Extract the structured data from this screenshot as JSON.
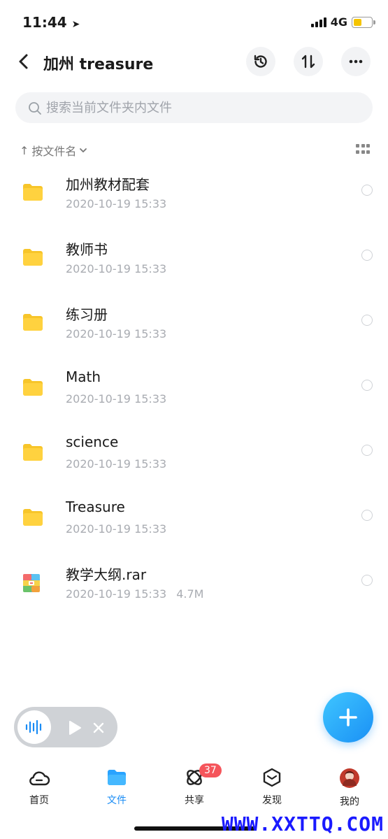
{
  "status_bar": {
    "time": "11:44",
    "network": "4G"
  },
  "header": {
    "title": "加州 treasure"
  },
  "search": {
    "placeholder": "搜索当前文件夹内文件"
  },
  "sort": {
    "label": "按文件名"
  },
  "files": [
    {
      "name": "加州教材配套",
      "date": "2020-10-19 15:33",
      "size": "",
      "type": "folder"
    },
    {
      "name": "教师书",
      "date": "2020-10-19 15:33",
      "size": "",
      "type": "folder"
    },
    {
      "name": "练习册",
      "date": "2020-10-19 15:33",
      "size": "",
      "type": "folder"
    },
    {
      "name": "Math",
      "date": "2020-10-19 15:33",
      "size": "",
      "type": "folder"
    },
    {
      "name": "science",
      "date": "2020-10-19 15:33",
      "size": "",
      "type": "folder"
    },
    {
      "name": "Treasure",
      "date": "2020-10-19 15:33",
      "size": "",
      "type": "folder"
    },
    {
      "name": "教学大纲.rar",
      "date": "2020-10-19 15:33",
      "size": "4.7M",
      "type": "rar"
    }
  ],
  "tabs": [
    {
      "label": "首页",
      "icon": "cloud-icon"
    },
    {
      "label": "文件",
      "icon": "folder-icon"
    },
    {
      "label": "共享",
      "icon": "orbit-icon",
      "badge": "37"
    },
    {
      "label": "发现",
      "icon": "box-icon"
    },
    {
      "label": "我的",
      "icon": "avatar"
    }
  ],
  "watermark": "WWW.XXTTQ.COM",
  "colors": {
    "accent": "#1a8cf5",
    "folder": "#ffd23f",
    "badge": "#f5555b",
    "battery": "#f5c400"
  }
}
